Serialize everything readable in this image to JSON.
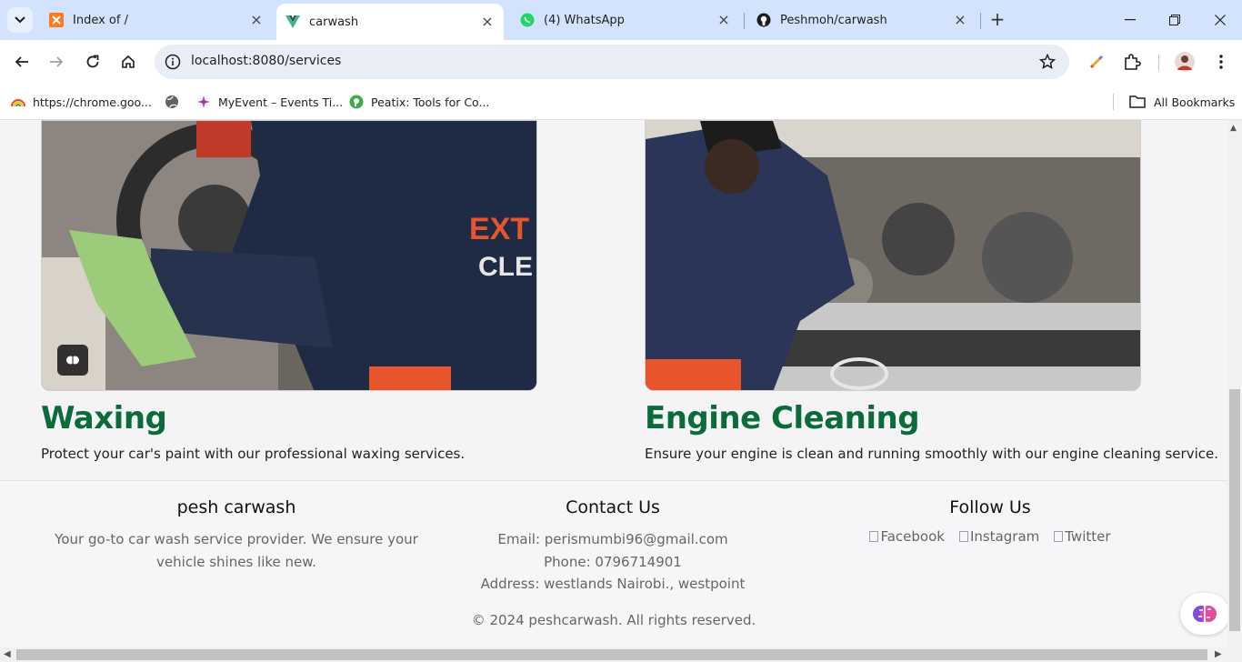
{
  "browser": {
    "tabs": [
      {
        "title": "Index of /",
        "icon": "xampp-icon"
      },
      {
        "title": "carwash",
        "icon": "vue-icon",
        "active": true
      },
      {
        "title": "(4) WhatsApp",
        "icon": "whatsapp-icon"
      },
      {
        "title": "Peshmoh/carwash",
        "icon": "github-icon"
      }
    ],
    "new_tab_label": "+",
    "url": "localhost:8080/services",
    "bookmarks": [
      {
        "label": "https://chrome.goo...",
        "icon": "rainbow-icon"
      },
      {
        "label": "",
        "icon": "globe-icon"
      },
      {
        "label": "MyEvent – Events Ti...",
        "icon": "myevent-icon"
      },
      {
        "label": "Peatix: Tools for Co...",
        "icon": "peatix-icon"
      }
    ],
    "all_bookmarks_label": "All Bookmarks"
  },
  "services": [
    {
      "title": "Waxing",
      "description": "Protect your car's paint with our professional waxing services.",
      "image": "interior-cleaning-photo"
    },
    {
      "title": "Engine Cleaning",
      "description": "Ensure your engine is clean and running smoothly with our engine cleaning service.",
      "image": "engine-cleaning-photo"
    }
  ],
  "footer": {
    "about": {
      "heading": "pesh carwash",
      "text_line1": "Your go-to car wash service provider. We ensure your",
      "text_line2": "vehicle shines like new."
    },
    "contact": {
      "heading": "Contact Us",
      "email": "Email: perismumbi96@gmail.com",
      "phone": "Phone: 0796714901",
      "address": "Address: westlands Nairobi., westpoint"
    },
    "follow": {
      "heading": "Follow Us",
      "links": [
        "Facebook",
        "Instagram",
        "Twitter"
      ]
    },
    "copyright": "© 2024 peshcarwash. All rights reserved."
  },
  "colors": {
    "title_green": "#0b6b3a",
    "tabstrip": "#d3e3fd",
    "omnibox": "#e9eef6"
  }
}
